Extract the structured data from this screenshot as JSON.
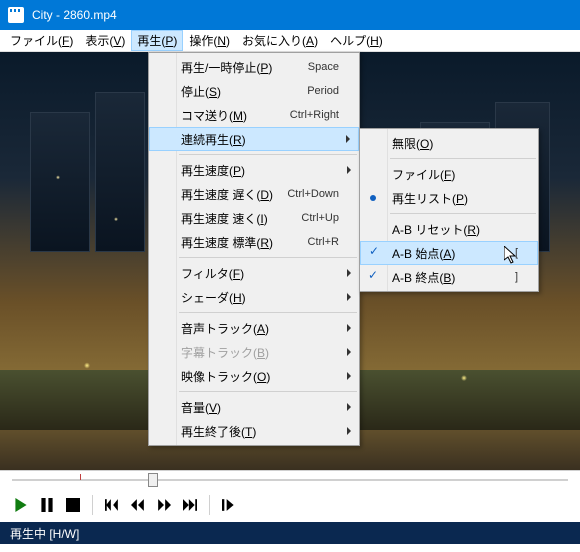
{
  "title": "City - 2860.mp4",
  "menubar": [
    "ファイル(F)",
    "表示(V)",
    "再生(P)",
    "操作(N)",
    "お気に入り(A)",
    "ヘルプ(H)"
  ],
  "menubar_underline": [
    "F",
    "V",
    "P",
    "N",
    "A",
    "H"
  ],
  "menu_main": [
    {
      "type": "item",
      "label": "再生/一時停止(P)",
      "u": "P",
      "shortcut": "Space"
    },
    {
      "type": "item",
      "label": "停止(S)",
      "u": "S",
      "shortcut": "Period"
    },
    {
      "type": "item",
      "label": "コマ送り(M)",
      "u": "M",
      "shortcut": "Ctrl+Right"
    },
    {
      "type": "item",
      "label": "連続再生(R)",
      "u": "R",
      "submenu": true,
      "highlighted": true
    },
    {
      "type": "sep"
    },
    {
      "type": "item",
      "label": "再生速度(P)",
      "u": "P",
      "submenu": true
    },
    {
      "type": "item",
      "label": "再生速度 遅く(D)",
      "u": "D",
      "shortcut": "Ctrl+Down"
    },
    {
      "type": "item",
      "label": "再生速度 速く(I)",
      "u": "I",
      "shortcut": "Ctrl+Up"
    },
    {
      "type": "item",
      "label": "再生速度 標準(R)",
      "u": "R",
      "shortcut": "Ctrl+R"
    },
    {
      "type": "sep"
    },
    {
      "type": "item",
      "label": "フィルタ(F)",
      "u": "F",
      "submenu": true
    },
    {
      "type": "item",
      "label": "シェーダ(H)",
      "u": "H",
      "submenu": true
    },
    {
      "type": "sep"
    },
    {
      "type": "item",
      "label": "音声トラック(A)",
      "u": "A",
      "submenu": true
    },
    {
      "type": "item",
      "label": "字幕トラック(B)",
      "u": "B",
      "submenu": true,
      "disabled": true
    },
    {
      "type": "item",
      "label": "映像トラック(O)",
      "u": "O",
      "submenu": true
    },
    {
      "type": "sep"
    },
    {
      "type": "item",
      "label": "音量(V)",
      "u": "V",
      "submenu": true
    },
    {
      "type": "item",
      "label": "再生終了後(T)",
      "u": "T",
      "submenu": true
    }
  ],
  "menu_sub": [
    {
      "type": "item",
      "label": "無限(O)",
      "u": "O"
    },
    {
      "type": "sep"
    },
    {
      "type": "item",
      "label": "ファイル(F)",
      "u": "F"
    },
    {
      "type": "item",
      "label": "再生リスト(P)",
      "u": "P",
      "radio": true
    },
    {
      "type": "sep"
    },
    {
      "type": "item",
      "label": "A-B リセット(R)",
      "u": "R"
    },
    {
      "type": "item",
      "label": "A-B 始点(A)",
      "u": "A",
      "shortcut": "[",
      "checked": true,
      "highlighted": true
    },
    {
      "type": "item",
      "label": "A-B 終点(B)",
      "u": "B",
      "shortcut": "]",
      "checked": true
    }
  ],
  "status": "再生中 [H/W]"
}
